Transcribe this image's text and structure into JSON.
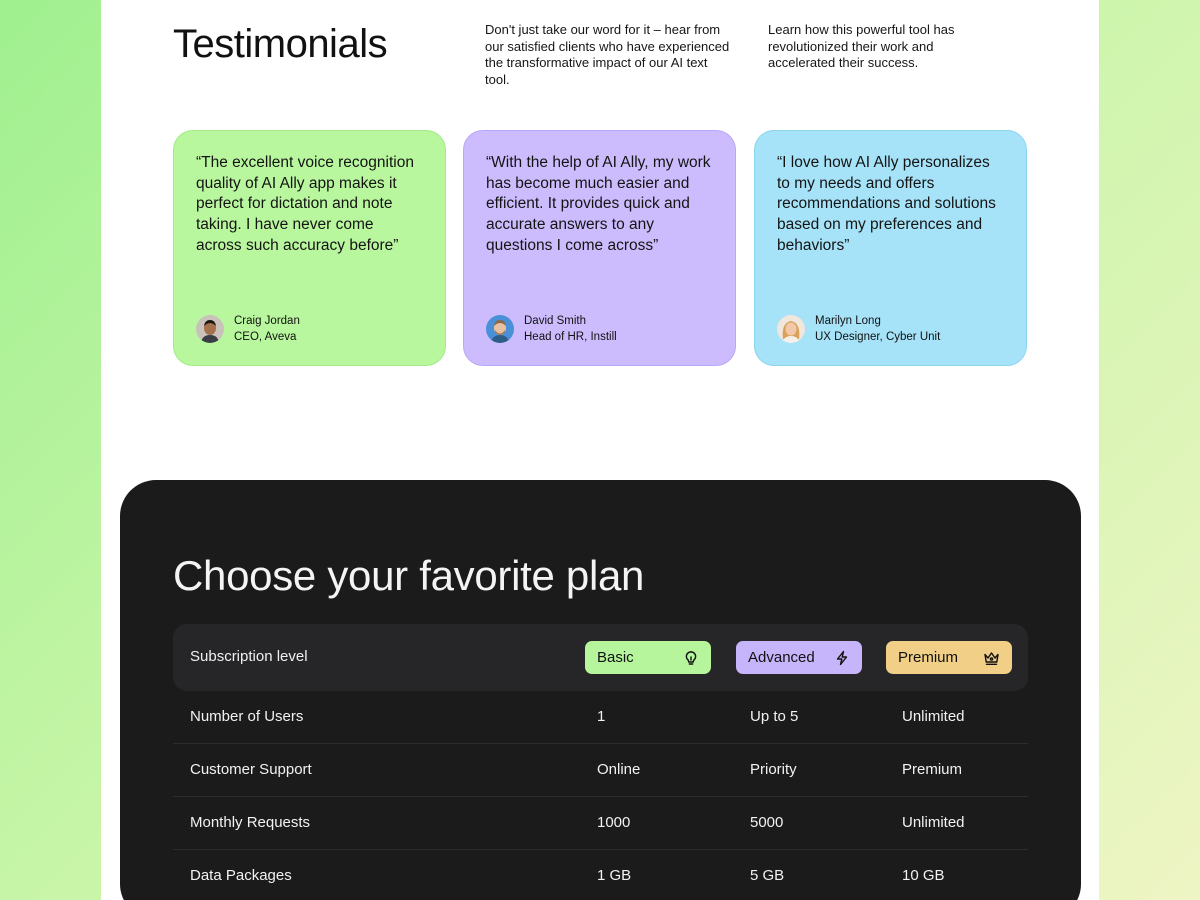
{
  "testimonials": {
    "title": "Testimonials",
    "desc1": "Don't just take our word for it – hear from our satisfied clients who have experienced the transformative impact of our AI text tool.",
    "desc2": "Learn how this powerful tool has revolutionized their work and accelerated their success.",
    "cards": [
      {
        "quote": "“The excellent voice recognition quality of AI Ally app makes it perfect for dictation and note taking. I have never come across such accuracy before”",
        "name": "Craig Jordan",
        "role": "CEO, Aveva",
        "color": "#b9f79e"
      },
      {
        "quote": "“With the help of AI Ally, my work has become much easier and efficient. It provides quick and accurate answers to any questions I come across”",
        "name": "David Smith",
        "role": "Head of HR, Instill",
        "color": "#ccbcfd"
      },
      {
        "quote": "“I love how AI Ally personalizes to my needs and offers recommendations and solutions based on my preferences and behaviors”",
        "name": "Marilyn Long",
        "role": "UX Designer, Cyber Unit",
        "color": "#a6e3f8"
      }
    ]
  },
  "plans": {
    "title": "Choose your favorite plan",
    "header_label": "Subscription level",
    "tiers": [
      {
        "label": "Basic",
        "icon": "lightbulb-icon",
        "color": "#b7f59c"
      },
      {
        "label": "Advanced",
        "icon": "lightning-icon",
        "color": "#c7b5fb"
      },
      {
        "label": "Premium",
        "icon": "crown-icon",
        "color": "#f1cf87"
      }
    ],
    "rows": [
      {
        "label": "Number of Users",
        "basic": "1",
        "advanced": "Up to 5",
        "premium": "Unlimited"
      },
      {
        "label": "Customer Support",
        "basic": "Online",
        "advanced": "Priority",
        "premium": "Premium"
      },
      {
        "label": "Monthly Requests",
        "basic": "1000",
        "advanced": "5000",
        "premium": "Unlimited"
      },
      {
        "label": "Data Packages",
        "basic": "1 GB",
        "advanced": "5 GB",
        "premium": "10 GB"
      }
    ]
  }
}
